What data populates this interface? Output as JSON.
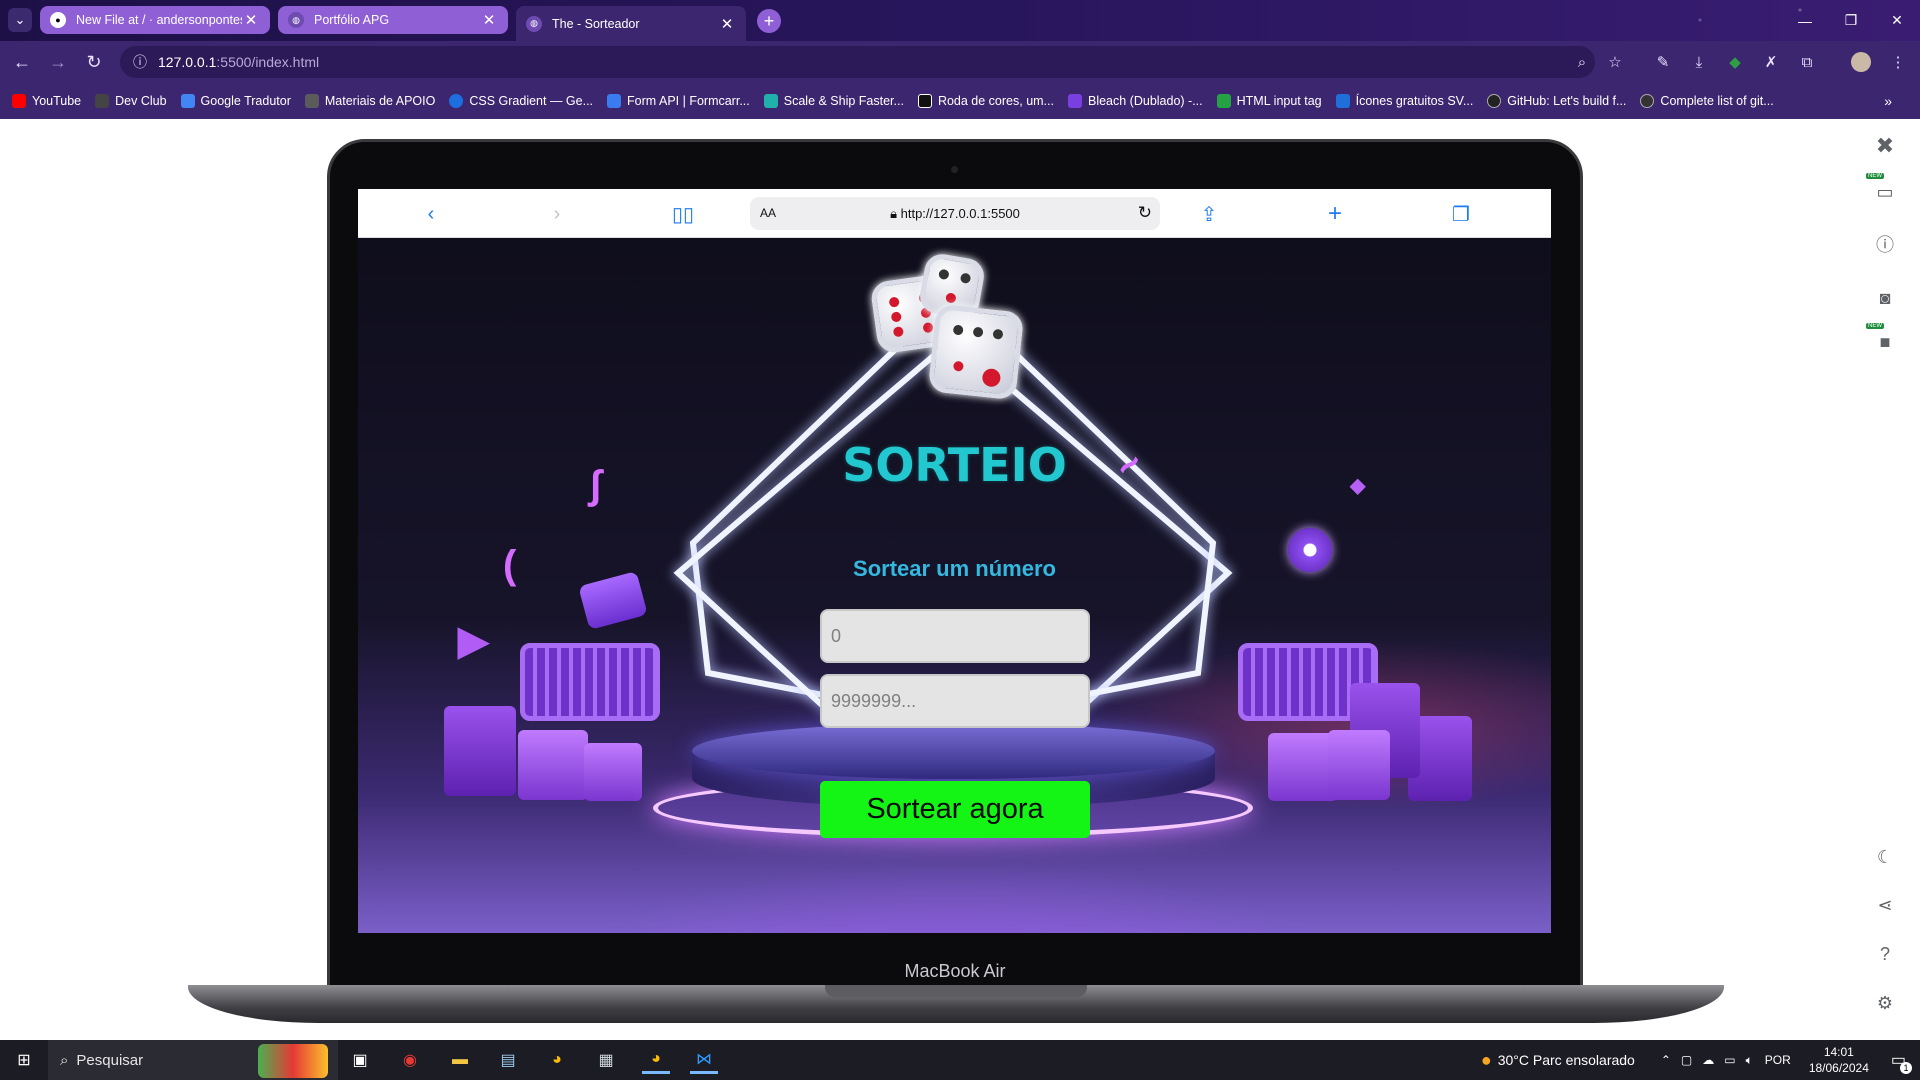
{
  "browser": {
    "tabs": [
      {
        "title": "New File at / · andersonpontes",
        "favicon": "github-icon",
        "active": false
      },
      {
        "title": "Portfólio APG",
        "favicon": "globe-icon",
        "active": false
      },
      {
        "title": "The - Sorteador",
        "favicon": "globe-icon",
        "active": true
      }
    ],
    "url_host": "127.0.0.1",
    "url_rest": ":5500/index.html",
    "bookmarks": [
      {
        "label": "YouTube",
        "color": "#ff0000"
      },
      {
        "label": "Dev Club",
        "color": "#444444"
      },
      {
        "label": "Google Tradutor",
        "color": "#4285f4"
      },
      {
        "label": "Materiais de APOIO",
        "color": "#5b5b5b"
      },
      {
        "label": "CSS Gradient — Ge...",
        "color": "#1d6fe0"
      },
      {
        "label": "Form API | Formcarr...",
        "color": "#3b7bf0"
      },
      {
        "label": "Scale & Ship Faster...",
        "color": "#20b2aa"
      },
      {
        "label": "Roda de cores, um...",
        "color": "#111111"
      },
      {
        "label": "Bleach (Dublado) -...",
        "color": "#7a3fe0"
      },
      {
        "label": "HTML input tag",
        "color": "#25a244"
      },
      {
        "label": "Ícones gratuitos SV...",
        "color": "#1e6fd9"
      },
      {
        "label": "GitHub: Let's build f...",
        "color": "#222222"
      },
      {
        "label": "Complete list of git...",
        "color": "#333333"
      }
    ]
  },
  "device": {
    "label": "MacBook Air",
    "safari_aa": "AA",
    "safari_url": "http://127.0.0.1:5500"
  },
  "app": {
    "title": "SORTEIO",
    "subtitle": "Sortear um número",
    "min_placeholder": "0",
    "max_placeholder": "9999999...",
    "button_label": "Sortear agora",
    "colors": {
      "title": "#22c7cf",
      "subtitle": "#34b8e0",
      "button": "#14f516"
    }
  },
  "taskbar": {
    "search_placeholder": "Pesquisar",
    "weather": "30°C  Parc ensolarado",
    "language": "POR",
    "time": "14:01",
    "date": "18/06/2024",
    "notifications": "1"
  }
}
